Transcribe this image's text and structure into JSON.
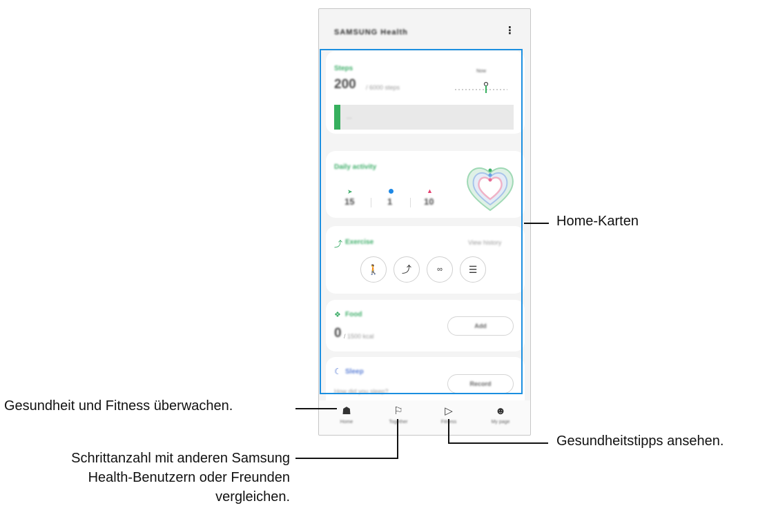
{
  "app": {
    "title": "SAMSUNG Health",
    "more_icon": "more-vertical-icon"
  },
  "steps_card": {
    "label": "Steps",
    "value": "200",
    "target": "6000 steps",
    "progress": 0.033,
    "chart_label": "Now",
    "bar_text": "..."
  },
  "activity_card": {
    "label": "Daily activity",
    "stats": [
      {
        "icon": "shoe-icon",
        "value": "15",
        "color": "#3fae6a"
      },
      {
        "icon": "clock-icon",
        "value": "1",
        "color": "#1e88e5"
      },
      {
        "icon": "flame-icon",
        "value": "10",
        "color": "#e53f6f"
      }
    ]
  },
  "exercise_card": {
    "label": "Exercise",
    "link": "View history",
    "buttons": [
      "walking-icon",
      "running-icon",
      "cycling-icon",
      "list-icon"
    ]
  },
  "food_card": {
    "label": "Food",
    "value": "0",
    "target": "1500 kcal",
    "button": "Add"
  },
  "sleep_card": {
    "label": "Sleep",
    "prompt": "How did you sleep?",
    "button": "Record"
  },
  "nav": [
    {
      "icon": "home-icon",
      "label": "Home"
    },
    {
      "icon": "flag-icon",
      "label": "Together"
    },
    {
      "icon": "play-icon",
      "label": "Fitness"
    },
    {
      "icon": "person-icon",
      "label": "My page"
    }
  ],
  "callouts": {
    "home_cards": "Home-Karten",
    "health": "Gesundheit und Fitness überwachen.",
    "tips": "Gesundheitstipps ansehen.",
    "compare_line1": "Schrittanzahl mit anderen Samsung",
    "compare_line2": "Health-Benutzern oder Freunden",
    "compare_line3": "vergleichen."
  },
  "colors": {
    "accent_green": "#3fae6a",
    "highlight_blue": "#1b8fe0",
    "sleep_blue": "#5b7fd6"
  }
}
